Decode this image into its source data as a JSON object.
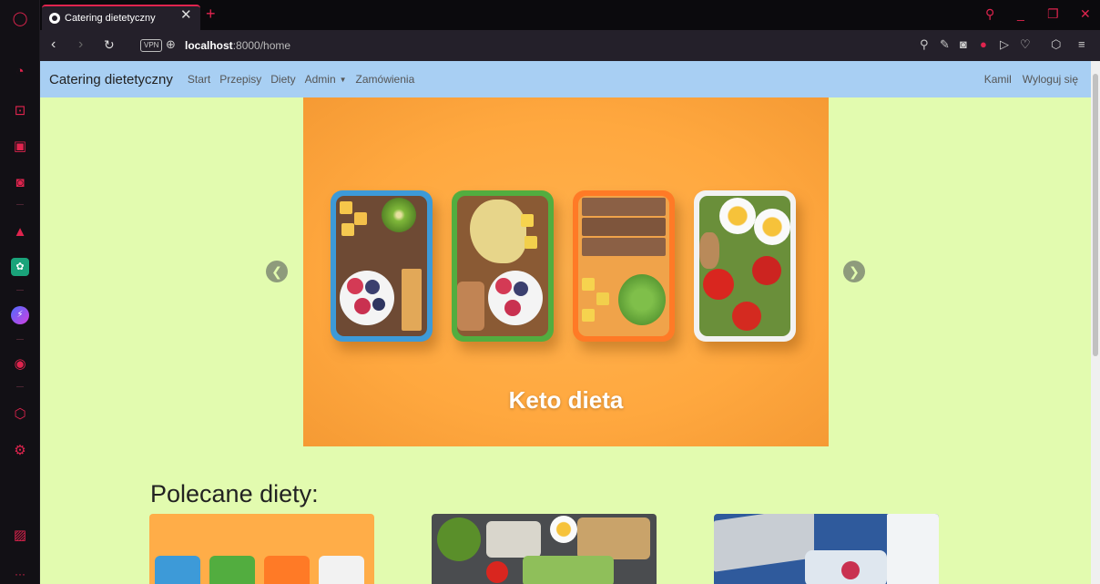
{
  "browser": {
    "tab_title": "Catering dietetyczny",
    "url_host": "localhost",
    "url_path": ":8000/home",
    "vpn_label": "VPN"
  },
  "navbar": {
    "brand": "Catering dietetyczny",
    "links": [
      "Start",
      "Przepisy",
      "Diety",
      "Admin",
      "Zamówienia"
    ],
    "user": "Kamil",
    "logout": "Wyloguj się"
  },
  "carousel": {
    "caption": "Keto dieta"
  },
  "recommended": {
    "title": "Polecane diety:"
  },
  "colors": {
    "accent": "#e0244e",
    "navbar_bg": "#a8cff3",
    "page_bg": "#e2fbaf",
    "carousel_bg": "#ffa83f"
  }
}
